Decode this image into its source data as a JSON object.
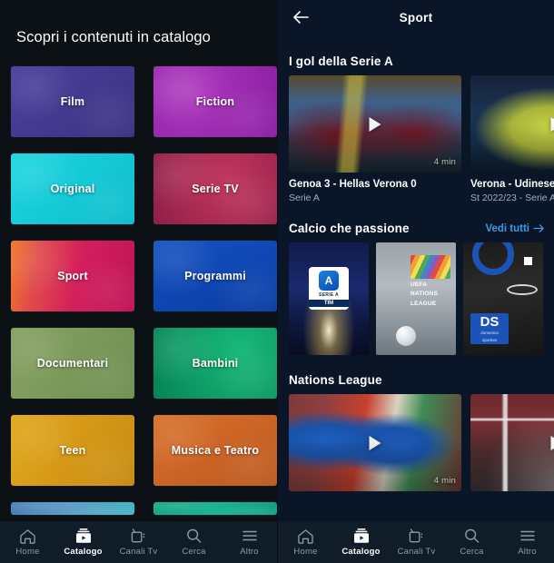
{
  "left_panel": {
    "title": "Scopri i contenuti in catalogo",
    "tiles": [
      {
        "label": "Film",
        "art": "art-film"
      },
      {
        "label": "Fiction",
        "art": "art-fiction"
      },
      {
        "label": "Original",
        "art": "art-original"
      },
      {
        "label": "Serie TV",
        "art": "art-serietv"
      },
      {
        "label": "Sport",
        "art": "art-sport"
      },
      {
        "label": "Programmi",
        "art": "art-programmi"
      },
      {
        "label": "Documentari",
        "art": "art-documentari"
      },
      {
        "label": "Bambini",
        "art": "art-bambini"
      },
      {
        "label": "Teen",
        "art": "art-teen"
      },
      {
        "label": "Musica e Teatro",
        "art": "art-musica"
      }
    ],
    "partial_tiles": [
      {
        "label": "",
        "art": "art-p1"
      },
      {
        "label": "",
        "art": "art-p2"
      }
    ]
  },
  "right_panel": {
    "topbar": {
      "title": "Sport",
      "back_icon": "back-arrow-icon"
    },
    "sections": [
      {
        "title": "I gol della Serie A",
        "see_all": null,
        "type": "video-rail",
        "cards": [
          {
            "title": "Genoa 3 - Hellas Verona 0",
            "subtitle": "Serie A",
            "duration": "4 min",
            "art": "th-genoa"
          },
          {
            "title": "Verona - Udinese",
            "subtitle": "St 2022/23 - Serie A",
            "duration": "",
            "art": "th-verona"
          }
        ]
      },
      {
        "title": "Calcio che passione",
        "see_all": "Vedi tutti",
        "type": "poster-rail",
        "posters": [
          {
            "name": "Serie A TIM",
            "art": "po-seriea"
          },
          {
            "name": "UEFA Nations League",
            "art": "po-uefa"
          },
          {
            "name": "DS Domenica Sportiva",
            "art": "po-ds"
          }
        ]
      },
      {
        "title": "Nations League",
        "see_all": null,
        "type": "video-rail",
        "cards": [
          {
            "title": "",
            "subtitle": "",
            "duration": "4 min",
            "art": "th-italy"
          },
          {
            "title": "",
            "subtitle": "",
            "duration": "",
            "art": "th-goal"
          }
        ]
      }
    ]
  },
  "bottom_nav": {
    "items": [
      {
        "label": "Home",
        "icon": "home-icon",
        "active": false
      },
      {
        "label": "Catalogo",
        "icon": "catalog-icon",
        "active": true
      },
      {
        "label": "Canali Tv",
        "icon": "tv-icon",
        "active": false
      },
      {
        "label": "Cerca",
        "icon": "search-icon",
        "active": false
      },
      {
        "label": "Altro",
        "icon": "hamburger-icon",
        "active": false
      }
    ]
  },
  "colors": {
    "left_bg": "#0b1015",
    "right_bg": "#0a1628",
    "nav_bg": "#111c29",
    "accent_link": "#3d9ae8",
    "text_primary": "#ffffff",
    "text_secondary": "#9fb0c4"
  },
  "poster_text": {
    "seriea_mark": "A",
    "seriea_name": "SERIE A",
    "seriea_sponsor": "TIM",
    "uefa_line1": "UEFA",
    "uefa_line2": "NATIONS",
    "uefa_line3": "LEAGUE",
    "ds_mark": "DS",
    "ds_sub1": "domenica",
    "ds_sub2": "sportiva"
  }
}
